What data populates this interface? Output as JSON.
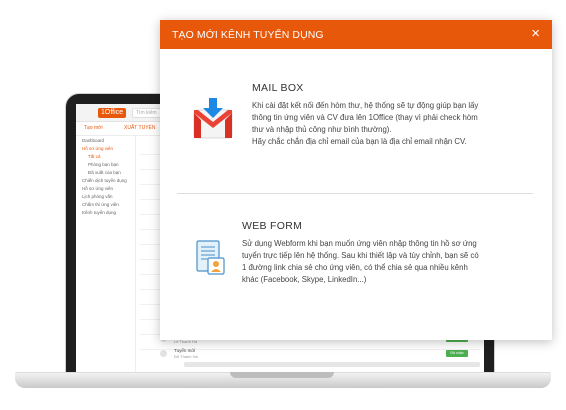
{
  "background_app": {
    "logo": "1Office",
    "search_placeholder": "Tìm kiếm",
    "toolbar": {
      "add_label": "Tạo mới",
      "export_label": "XUẤT TUYỂN"
    },
    "sidebar": {
      "items": [
        {
          "label": "Dashboard"
        },
        {
          "label": "Hồ sơ ứng viên"
        },
        {
          "label": "Tất cả"
        },
        {
          "label": "Phòng ban bạn"
        },
        {
          "label": "Đã xuất của bạn"
        },
        {
          "label": "Chiến dịch tuyển dụng"
        },
        {
          "label": "Hồ sơ ứng viên"
        },
        {
          "label": "Lịch phỏng vấn"
        },
        {
          "label": "Chấm thi ứng viên"
        },
        {
          "label": "Kênh tuyển dụng"
        }
      ]
    },
    "rows": [
      {
        "title": "Quản trị viên",
        "sub": "Lê Thanh Hà",
        "status": "Đã nhận"
      },
      {
        "title": "Tuyển mới",
        "sub": "Đỗ Thanh Hà",
        "status": "Đã nhận"
      }
    ]
  },
  "modal": {
    "title": "TẠO MỚI KÊNH TUYỂN DỤNG",
    "close_symbol": "×",
    "accent_color": "#E8580B",
    "options": {
      "mailbox": {
        "title": "MAIL BOX",
        "icon": "gmail-envelope-icon",
        "desc": [
          "Khi cài đặt kết nối đến hòm thư, hệ thống sẽ tự động giúp bạn lấy",
          "thông tin ứng viên và CV đưa lên 1Office (thay vì phải check hòm",
          "thư và nhập thủ công như bình thường).",
          "Hãy chắc chắn địa chỉ email của bạn là địa chỉ email nhận CV."
        ]
      },
      "webform": {
        "title": "WEB FORM",
        "icon": "web-form-document-icon",
        "desc": [
          "Sử dụng Webform khi bạn muốn ứng viên nhập thông tin hồ sơ ứng",
          "tuyển trực tiếp lên hệ thống. Sau khi thiết lập và tùy chỉnh, bạn sẽ có",
          "1 đường link chia sẻ cho ứng viên, có thể chia sẻ qua nhiều kênh",
          "khác (Facebook, Skype, LinkedIn...)"
        ]
      }
    }
  }
}
